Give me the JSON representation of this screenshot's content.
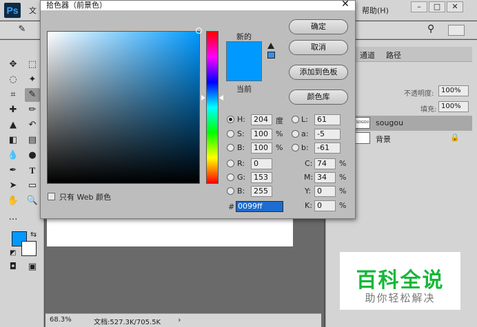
{
  "photoshop": {
    "logo": "Ps",
    "menu_partial": "文",
    "menu_help": "帮助(H)",
    "window_min": "–",
    "window_restore": "□",
    "window_close": "✕",
    "status_zoom": "68.3%",
    "status_doc": "文档:527.3K/705.5K",
    "status_arrow": "›",
    "panel_tabs": [
      "通道",
      "路径"
    ],
    "opacity_label": "不透明度:",
    "opacity_value": "100%",
    "fill_label": "填充:",
    "fill_value": "100%",
    "layers": [
      {
        "name": "sougou",
        "thumb": "SOGOU"
      },
      {
        "name": "背景"
      }
    ]
  },
  "colors": {
    "current": "#0099ff",
    "background": "#ffffff"
  },
  "dialog": {
    "title": "拾色器（前景色）",
    "close": "✕",
    "label_new": "新的",
    "label_current": "当前",
    "buttons": {
      "ok": "确定",
      "cancel": "取消",
      "add_swatch": "添加到色板",
      "color_library": "颜色库"
    },
    "hsb": [
      {
        "label": "H:",
        "value": "204",
        "unit": "度",
        "selected": true
      },
      {
        "label": "S:",
        "value": "100",
        "unit": "%",
        "selected": false
      },
      {
        "label": "B:",
        "value": "100",
        "unit": "%",
        "selected": false
      }
    ],
    "rgb": [
      {
        "label": "R:",
        "value": "0"
      },
      {
        "label": "G:",
        "value": "153"
      },
      {
        "label": "B:",
        "value": "255"
      }
    ],
    "lab": [
      {
        "label": "L:",
        "value": "61"
      },
      {
        "label": "a:",
        "value": "-5"
      },
      {
        "label": "b:",
        "value": "-61"
      }
    ],
    "cmyk": [
      {
        "label": "C:",
        "value": "74",
        "unit": "%"
      },
      {
        "label": "M:",
        "value": "34",
        "unit": "%"
      },
      {
        "label": "Y:",
        "value": "0",
        "unit": "%"
      },
      {
        "label": "K:",
        "value": "0",
        "unit": "%"
      }
    ],
    "hex_label": "#",
    "hex_value": "0099ff",
    "web_only_label": "只有 Web 颜色"
  },
  "watermark": {
    "title": "百科全说",
    "subtitle": "助你轻松解决"
  }
}
